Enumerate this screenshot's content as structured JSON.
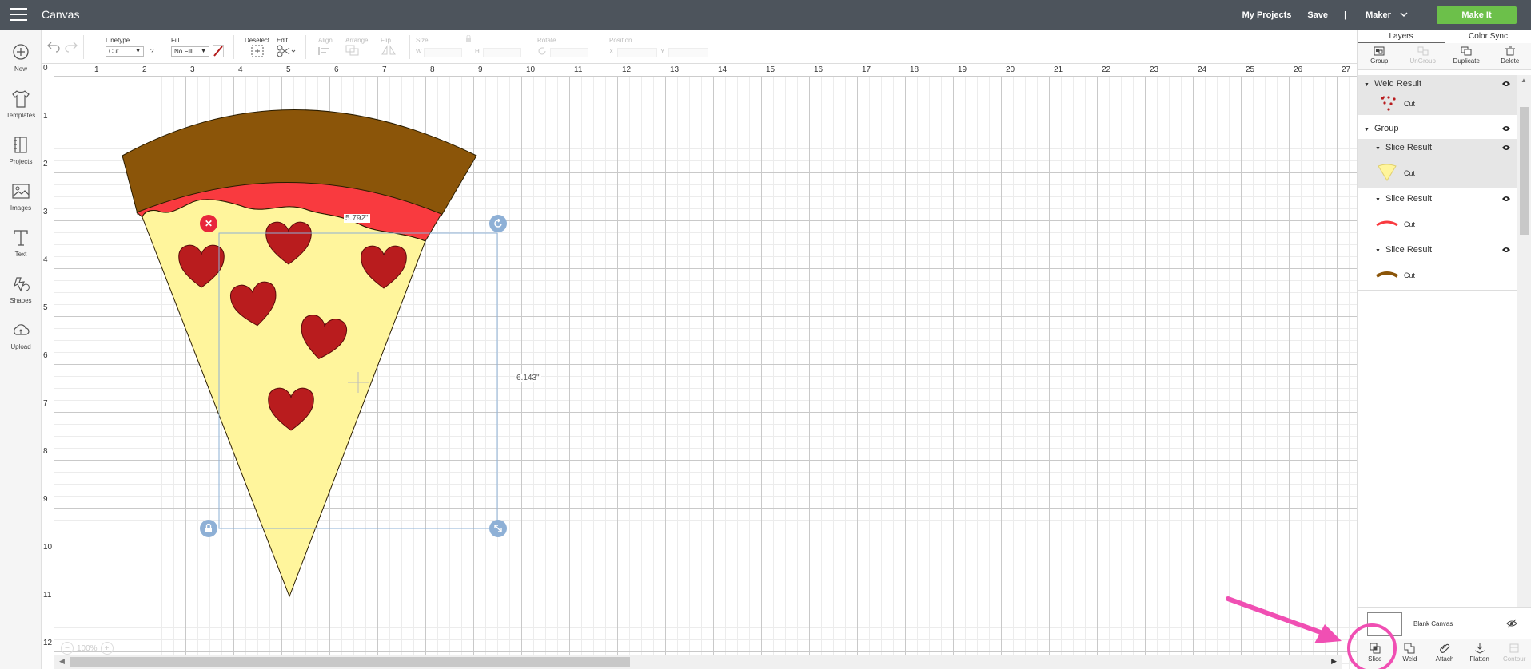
{
  "topbar": {
    "title": "Canvas",
    "my_projects": "My Projects",
    "save": "Save",
    "separator": "|",
    "machine": "Maker",
    "make_it": "Make It"
  },
  "toolbar": {
    "linetype_label": "Linetype",
    "linetype_value": "Cut",
    "help": "?",
    "fill_label": "Fill",
    "fill_value": "No Fill",
    "deselect": "Deselect",
    "edit": "Edit",
    "align": "Align",
    "arrange": "Arrange",
    "flip": "Flip",
    "size": "Size",
    "size_w": "W",
    "size_h": "H",
    "rotate": "Rotate",
    "position": "Position",
    "position_x": "X",
    "position_y": "Y"
  },
  "sidebar": {
    "items": [
      {
        "label": "New",
        "icon": "plus-circle-icon"
      },
      {
        "label": "Templates",
        "icon": "tshirt-icon"
      },
      {
        "label": "Projects",
        "icon": "projects-icon"
      },
      {
        "label": "Images",
        "icon": "image-icon"
      },
      {
        "label": "Text",
        "icon": "text-icon"
      },
      {
        "label": "Shapes",
        "icon": "shapes-icon"
      },
      {
        "label": "Upload",
        "icon": "cloud-upload-icon"
      }
    ]
  },
  "canvas": {
    "ruler_top": [
      "0",
      "1",
      "2",
      "3",
      "4",
      "5",
      "6",
      "7",
      "8",
      "9",
      "10",
      "11",
      "12",
      "13",
      "14",
      "15",
      "16",
      "17",
      "18",
      "19",
      "20",
      "21",
      "22",
      "23",
      "24",
      "25",
      "26",
      "27"
    ],
    "ruler_left": [
      "0",
      "1",
      "2",
      "3",
      "4",
      "5",
      "6",
      "7",
      "8",
      "9",
      "10",
      "11",
      "12"
    ],
    "width_label": "5.792\"",
    "height_label": "6.143\"",
    "zoom": "100%",
    "colors": {
      "crust": "#8b5509",
      "sauce": "#f93a3f",
      "cheese": "#fff59c",
      "pepperoni": "#b91c1e",
      "selection": "#8eb0d6",
      "delete_handle": "#e8263b",
      "other_handle": "#8eb0d6"
    }
  },
  "panel": {
    "tabs": [
      "Layers",
      "Color Sync"
    ],
    "actions": [
      {
        "label": "Group",
        "disabled": false
      },
      {
        "label": "UnGroup",
        "disabled": true
      },
      {
        "label": "Duplicate",
        "disabled": false
      },
      {
        "label": "Delete",
        "disabled": false
      }
    ],
    "layers": {
      "weld_title": "Weld Result",
      "weld_sub": "Cut",
      "group_title": "Group",
      "slice1_title": "Slice Result",
      "slice1_sub": "Cut",
      "slice2_title": "Slice Result",
      "slice2_sub": "Cut",
      "slice3_title": "Slice Result",
      "slice3_sub": "Cut"
    },
    "blank_canvas": "Blank Canvas",
    "bottom_actions": [
      {
        "label": "Slice",
        "disabled": false
      },
      {
        "label": "Weld",
        "disabled": false
      },
      {
        "label": "Attach",
        "disabled": false
      },
      {
        "label": "Flatten",
        "disabled": false
      },
      {
        "label": "Contour",
        "disabled": true
      }
    ]
  },
  "annotation": {
    "color": "#f04fb3"
  }
}
